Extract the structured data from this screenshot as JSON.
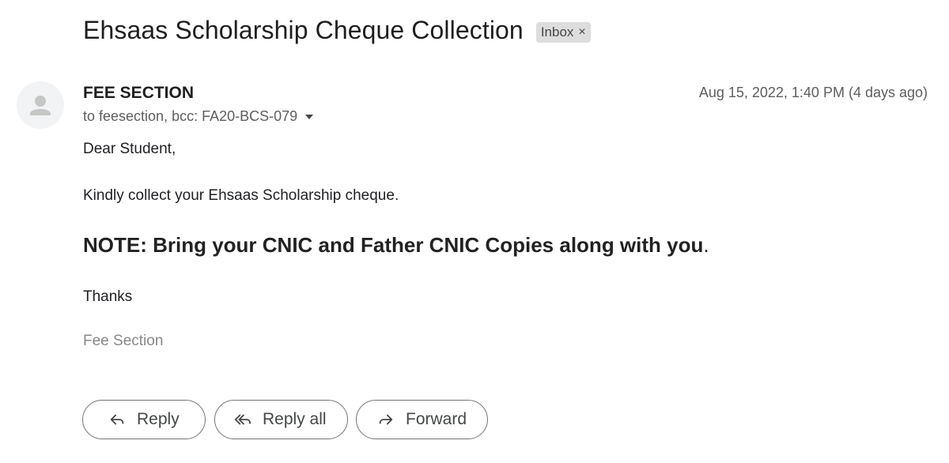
{
  "email": {
    "subject": "Ehsaas Scholarship Cheque Collection",
    "label": "Inbox",
    "label_remove": "×",
    "sender": "FEE SECTION",
    "recipients": "to feesection, bcc: FA20-BCS-079",
    "date": "Aug 15, 2022, 1:40 PM (4 days ago)",
    "body": {
      "greeting": "Dear Student,",
      "line1": "Kindly collect your Ehsaas Scholarship cheque.",
      "note_bold": "NOTE: Bring your CNIC and Father CNIC Copies along with you",
      "note_tail": ".",
      "thanks": "Thanks",
      "signature": "Fee Section"
    }
  },
  "actions": {
    "reply": "Reply",
    "reply_all": "Reply all",
    "forward": "Forward"
  },
  "icons": {
    "avatar": "person-icon",
    "reply": "reply-icon",
    "reply_all": "reply-all-icon",
    "forward": "forward-icon",
    "details": "chevron-down-icon"
  },
  "colors": {
    "chip_bg": "#dddddd",
    "muted_text": "#5e5e5e",
    "signature": "#888888"
  }
}
